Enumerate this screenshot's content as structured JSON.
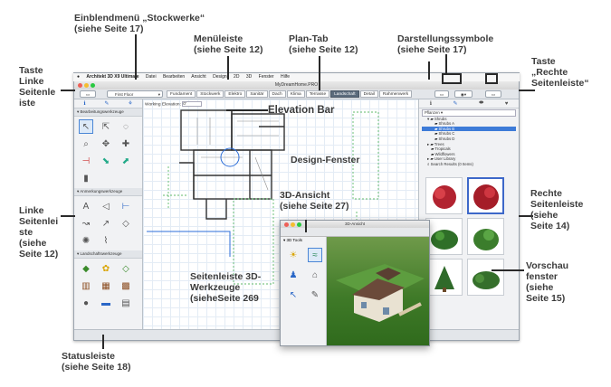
{
  "callouts": {
    "einblend": {
      "l1": "Einblendmenü „Stockwerke“",
      "l2": "(siehe Seite 17)"
    },
    "menue": {
      "l1": "Menüleiste",
      "l2": "(siehe Seite 12)"
    },
    "plantab": {
      "l1": "Plan-Tab",
      "l2": "(siehe Seite 12)"
    },
    "darst": {
      "l1": "Darstellungssymbole",
      "l2": "(siehe Seite 17)"
    },
    "taste_rechts": {
      "l1": "Taste",
      "l2": "„Rechte",
      "l3": "Seitenleiste“"
    },
    "taste_links": {
      "l1": "Taste",
      "l2": "Linke",
      "l3": "Seitenle",
      "l4": "iste"
    },
    "elevation": "Elevation Bar",
    "design": "Design-Fenster",
    "ansicht3d": {
      "l1": "3D-Ansicht",
      "l2": "(siehe Seite 27)"
    },
    "linke_leiste": {
      "l1": "Linke",
      "l2": "Seitenlei",
      "l3": "ste",
      "l4": "(siehe",
      "l5": "Seite 12)"
    },
    "rechte_leiste": {
      "l1": "Rechte",
      "l2": "Seitenleiste",
      "l3": "(siehe",
      "l4": "Seite 14)"
    },
    "vorschau": {
      "l1": "Vorschau",
      "l2": "fenster",
      "l3": "(siehe",
      "l4": "Seite 15)"
    },
    "werkzeuge3d": {
      "l1": "Seitenleiste 3D-",
      "l2": "Werkzeuge",
      "l3": "(sieheSeite 269"
    },
    "status": {
      "l1": "Statusleiste",
      "l2": "(siehe Seite 18)"
    }
  },
  "app": {
    "menubar": {
      "apple": "",
      "app_name": "Architekt 3D X9 Ultimate",
      "items": [
        "Datei",
        "Bearbeiten",
        "Ansicht",
        "Design",
        "2D",
        "3D",
        "Fenster",
        "Hilfe"
      ]
    },
    "window_title": "MyDreamHome.PRO",
    "floor_select": "First Floor",
    "plan_tabs": [
      "Fundament",
      "Stockwerk",
      "Elektro",
      "Sanitär",
      "Dach",
      "Klima",
      "Terrasse",
      "Landschaft",
      "Detail",
      "Rahmenwerk"
    ],
    "active_tab": "Landschaft",
    "elevation_label": "Working Elevation:",
    "elevation_value": "0'",
    "left_sections": [
      "Bearbeitungswerkzeuge",
      "Anmerkungswerkzeuge",
      "Landschaftswerkzeuge"
    ],
    "library": {
      "dropdown": "Pflanzen",
      "items": [
        "Shrubs",
        "Shrubs A",
        "Shrubs B",
        "Shrubs C",
        "Shrubs D",
        "Trees",
        "Tropicals",
        "Wildflowers",
        "User Library"
      ],
      "selected": "Shrubs B",
      "search_result": "Search Results (0 Items)"
    },
    "view3d": {
      "title": "3D-Ansicht",
      "tools_label": "3D Tools"
    }
  },
  "colors": {
    "accent": "#3d7bd8",
    "active_tab": "#5b6b7c",
    "shrub_red": "#c0252f",
    "grass": "#3f7a28"
  }
}
